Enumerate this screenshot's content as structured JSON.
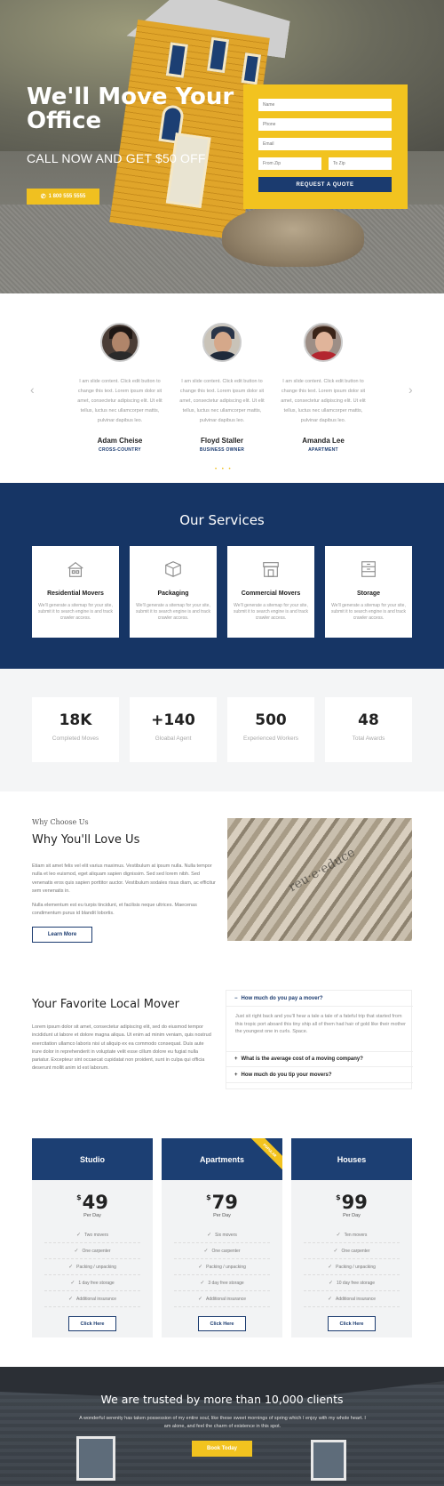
{
  "hero": {
    "title": "We'll Move Your Office",
    "subtitle": "CALL NOW AND GET $50 OFF",
    "phone_label": "1 800 555 5555",
    "form": {
      "name_placeholder": "Name",
      "phone_placeholder": "Phone",
      "email_placeholder": "Email",
      "from_placeholder": "From Zip",
      "to_placeholder": "To Zip",
      "submit_label": "REQUEST A QUOTE"
    }
  },
  "testimonials": {
    "prev_arrow": "‹",
    "next_arrow": "›",
    "dots": "• • •",
    "items": [
      {
        "text": "I am slide content. Click edit button to change this text. Lorem ipsum dolor sit amet, consectetur adipiscing elit. Ut elit tellus, luctus nec ullamcorper mattis, pulvinar dapibus leo.",
        "name": "Adam Cheise",
        "role": "CROSS-COUNTRY"
      },
      {
        "text": "I am slide content. Click edit button to change this text. Lorem ipsum dolor sit amet, consectetur adipiscing elit. Ut elit tellus, luctus nec ullamcorper mattis, pulvinar dapibus leo.",
        "name": "Floyd Staller",
        "role": "BUSINESS OWNER"
      },
      {
        "text": "I am slide content. Click edit button to change this text. Lorem ipsum dolor sit amet, consectetur adipiscing elit. Ut elit tellus, luctus nec ullamcorper mattis, pulvinar dapibus leo.",
        "name": "Amanda Lee",
        "role": "APARTMENT"
      }
    ]
  },
  "services": {
    "title": "Our Services",
    "items": [
      {
        "icon": "house-icon",
        "title": "Residential Movers",
        "desc": "We'll generate a sitemap for your site, submit it to search engine is and track crawler access."
      },
      {
        "icon": "box-icon",
        "title": "Packaging",
        "desc": "We'll generate a sitemap for your site, submit it to search engine is and track crawler access."
      },
      {
        "icon": "storefront-icon",
        "title": "Commercial Movers",
        "desc": "We'll generate a sitemap for your site, submit it to search engine is and track crawler access."
      },
      {
        "icon": "storage-icon",
        "title": "Storage",
        "desc": "We'll generate a sitemap for your site, submit it to search engine is and track crawler access."
      }
    ]
  },
  "stats": [
    {
      "num": "18K",
      "label": "Completed Moves"
    },
    {
      "num": "+140",
      "label": "Gloabal Agent"
    },
    {
      "num": "500",
      "label": "Experienced Workers"
    },
    {
      "num": "48",
      "label": "Total Awards"
    }
  ],
  "why": {
    "kicker": "Why Choose Us",
    "title": "Why You'll Love Us",
    "p1": "Etiam sit amet felis vel elit varius maximus. Vestibulum at ipsum nulla. Nulla tempor nulla et leo euismod, eget aliquam sapien dignissim. Sed sed lorem nibh. Sed venenatis eros quis sapien porttitor auctor. Vestibulum sodales risus diam, ac efficitur sem venenatis in.",
    "p2": "Nulla elementum est eu turpis tincidunt, et facilisis neque ultrices. Maecenas condimentum purus id blandit lobortis.",
    "button": "Learn More"
  },
  "faq": {
    "title": "Your Favorite Local Mover",
    "text": "Lorem ipsum dolor sit amet, consectetur adipiscing elit, sed do eiusmod tempor incididunt ut labore et dolore magna aliqua. Ut enim ad minim veniam, quis nostrud exercitation ullamco laboris nisi ut aliquip ex ea commodo consequat. Duis aute irure dolor in reprehenderit in voluptate velit esse cillum dolore eu fugiat nulla pariatur. Excepteur sint occaecat cupidatat non proident, sunt in culpa qui officia deserunt mollit anim id est laborum.",
    "items": [
      {
        "sign": "−",
        "q": "How much do you pay a mover?",
        "a": "Just sit right back and you'll hear a tale a tale of a fateful trip that started from this tropic port aboard this tiny ship all of them had hair of gold like their mother the youngest one in curls. Space."
      },
      {
        "sign": "+",
        "q": "What is the average cost of a moving company?"
      },
      {
        "sign": "+",
        "q": "How much do you tip your movers?"
      }
    ]
  },
  "pricing": [
    {
      "name": "Studio",
      "currency": "$",
      "price": "49",
      "per": "Per Day",
      "features": [
        "Two movers",
        "One carpenter",
        "Packing / unpacking",
        "1 day free storage",
        "Additional insurance"
      ],
      "button": "Click Here"
    },
    {
      "name": "Apartments",
      "ribbon": "POPULAR",
      "currency": "$",
      "price": "79",
      "per": "Per Day",
      "features": [
        "Six movers",
        "One carpenter",
        "Packing / unpacking",
        "3 day free storage",
        "Additional insurance"
      ],
      "button": "Click Here"
    },
    {
      "name": "Houses",
      "currency": "$",
      "price": "99",
      "per": "Per Day",
      "features": [
        "Ten movers",
        "One carpenter",
        "Packing / unpacking",
        "10 day free storage",
        "Additional insurance"
      ],
      "button": "Click Here"
    }
  ],
  "cta": {
    "title": "We are trusted by more than 10,000 clients",
    "text": "A wonderful serenity has taken possession of my entire soul, like these sweet mornings of spring which I enjoy with my whole heart. I am alone, and feel the charm of existence in this spot.",
    "button": "Book Today"
  },
  "colors": {
    "accent": "#f2c31f",
    "brand": "#1b3b6f",
    "services_bg": "#163565"
  }
}
